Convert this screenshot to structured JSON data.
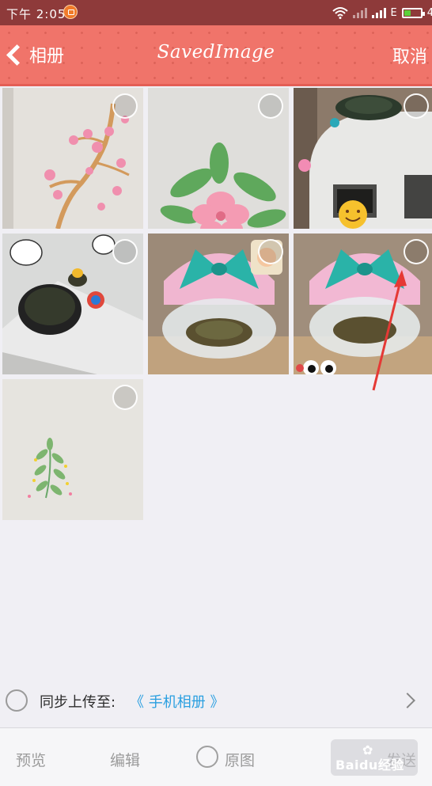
{
  "statusbar": {
    "time": "下午 2:05",
    "network": "E",
    "tail": "4"
  },
  "header": {
    "back_label": "相册",
    "title": "SavedImage",
    "cancel_label": "取消"
  },
  "grid": {
    "item_count": 7
  },
  "sync": {
    "label": "同步上传至:",
    "target": "《 手机相册 》"
  },
  "bottombar": {
    "preview_label": "预览",
    "edit_label": "编辑",
    "original_label": "原图",
    "send_label": "发送"
  },
  "watermark": {
    "text": "Baidu经验"
  },
  "colors": {
    "statusbar": "#8e3a3a",
    "header": "#f0746a",
    "link": "#2a9fe0",
    "background": "#f0eff4"
  }
}
